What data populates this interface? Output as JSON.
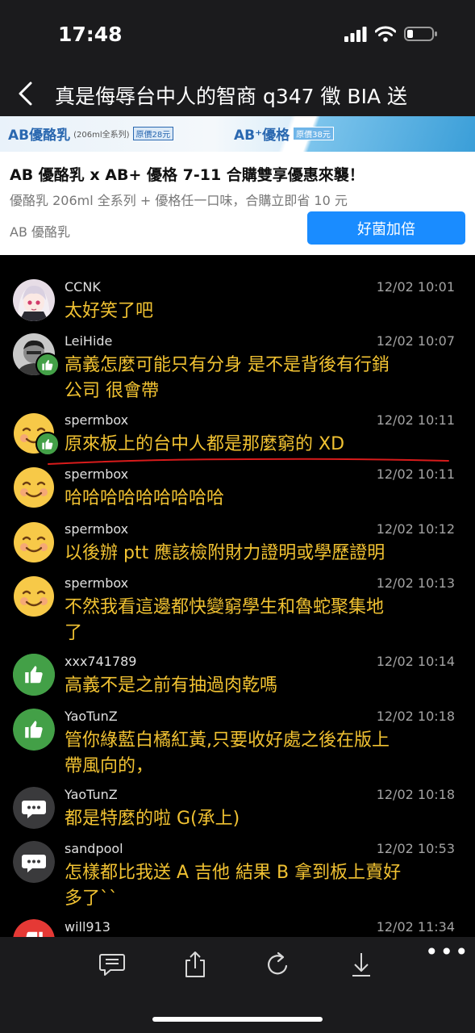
{
  "status": {
    "time": "17:48"
  },
  "nav": {
    "title": "真是侮辱台中人的智商 q347 徵 BIA 送"
  },
  "ad": {
    "banner": [
      {
        "brand": "AB優酪乳",
        "sub": "(206ml全系列)",
        "price": "原價28元"
      },
      {
        "brand": "AB⁺優格",
        "price": "原價38元"
      }
    ],
    "title": "AB 優酪乳 x AB+ 優格 7-11 合購雙享優惠來襲！",
    "desc": "優酪乳 206ml 全系列 + 優格任一口味，合購立即省 10 元",
    "brand": "AB 優酪乳",
    "cta": "好菌加倍"
  },
  "comments": [
    {
      "user": "CCNK",
      "time": "12/02 10:01",
      "lines": [
        "太好笑了吧"
      ],
      "avatar": "anime-girl",
      "badge": false
    },
    {
      "user": "LeiHide",
      "time": "12/02 10:07",
      "lines": [
        "高義怎麼可能只有分身 是不是背後有行銷",
        "公司 很會帶"
      ],
      "avatar": "person-photo",
      "badge": true
    },
    {
      "user": "spermbox",
      "time": "12/02 10:11",
      "lines": [
        "原來板上的台中人都是那麼窮的 XD"
      ],
      "avatar": "smile-emoji",
      "badge": true
    },
    {
      "user": "spermbox",
      "time": "12/02 10:11",
      "lines": [
        "哈哈哈哈哈哈哈哈哈"
      ],
      "avatar": "smile-emoji",
      "badge": false
    },
    {
      "user": "spermbox",
      "time": "12/02 10:12",
      "lines": [
        "以後辦 ptt 應該檢附財力證明或學歷證明"
      ],
      "avatar": "smile-emoji",
      "badge": false
    },
    {
      "user": "spermbox",
      "time": "12/02 10:13",
      "lines": [
        "不然我看這邊都快變窮學生和魯蛇聚集地",
        "了"
      ],
      "avatar": "smile-emoji",
      "badge": false
    },
    {
      "user": "xxx741789",
      "time": "12/02 10:14",
      "lines": [
        "高義不是之前有抽過肉乾嗎"
      ],
      "avatar": "thumbs-up",
      "badge": false
    },
    {
      "user": "YaoTunZ",
      "time": "12/02 10:18",
      "lines": [
        "管你綠藍白橘紅黃,只要收好處之後在版上",
        "帶風向的，"
      ],
      "avatar": "thumbs-up",
      "badge": false
    },
    {
      "user": "YaoTunZ",
      "time": "12/02 10:18",
      "lines": [
        "都是特麼的啦 G(承上)"
      ],
      "avatar": "chat-bubble",
      "badge": false
    },
    {
      "user": "sandpool",
      "time": "12/02 10:53",
      "lines": [
        "怎樣都比我送 A 吉他 結果 B 拿到板上賣好",
        "多了``"
      ],
      "avatar": "chat-bubble",
      "badge": false
    },
    {
      "user": "will913",
      "time": "12/02 11:34",
      "lines": [],
      "avatar": "thumbs-down",
      "badge": false
    }
  ],
  "toolbar": {
    "items": [
      "comment-icon",
      "share-icon",
      "refresh-icon",
      "download-icon"
    ],
    "more": "•••"
  },
  "colors": {
    "comment_text": "#f1c232",
    "accent_button": "#1a8cff",
    "like_badge": "#43a047",
    "underline": "#d81b1b"
  }
}
